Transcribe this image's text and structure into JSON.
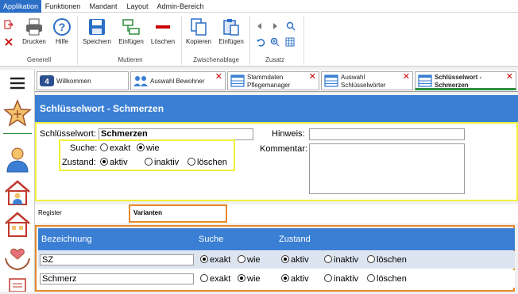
{
  "menubar": {
    "tabs": [
      {
        "label": "Applikation",
        "active": true
      },
      {
        "label": "Funktionen",
        "active": false
      },
      {
        "label": "Mandant",
        "active": false
      },
      {
        "label": "Layout",
        "active": false
      },
      {
        "label": "Admin-Bereich",
        "active": false
      }
    ]
  },
  "ribbon": {
    "print": "Drucken",
    "help": "Hilfe",
    "group_general": "Generell",
    "save": "Speichern",
    "insert": "Einfügen",
    "delete": "Löschen",
    "group_mutieren": "Mutieren",
    "copy": "Kopieren",
    "paste": "Einfügen",
    "group_clipboard": "Zwischenablage",
    "group_zusatz": "Zusatz"
  },
  "doctabs": [
    {
      "label": "Willkommen",
      "closable": false
    },
    {
      "label": "Auswahl Bewohner",
      "closable": true
    },
    {
      "label": "Stammdaten Pflegemanager",
      "closable": true
    },
    {
      "label": "Auswahl Schlüsselwörter",
      "closable": true
    },
    {
      "label": "Schlüsselwort - Schmerzen",
      "closable": true
    }
  ],
  "page": {
    "title": "Schlüsselwort - Schmerzen"
  },
  "form": {
    "keyword_label": "Schlüsselwort:",
    "keyword_value": "Schmerzen",
    "hint_label": "Hinweis:",
    "hint_value": "",
    "comment_label": "Kommentar:",
    "comment_value": "",
    "search_label": "Suche:",
    "search_options": [
      "exakt",
      "wie"
    ],
    "search_selected": "wie",
    "state_label": "Zustand:",
    "state_options": [
      "aktiv",
      "inaktiv",
      "löschen"
    ],
    "state_selected": "aktiv"
  },
  "subtabs": {
    "register": "Register",
    "variants": "Varianten"
  },
  "table": {
    "headers": [
      "Bezeichnung",
      "Suche",
      "Zustand"
    ],
    "rows": [
      {
        "name": "SZ",
        "search": "exakt",
        "state": "aktiv"
      },
      {
        "name": "Schmerz",
        "search": "wie",
        "state": "aktiv"
      }
    ],
    "search_options": [
      "exakt",
      "wie"
    ],
    "state_options": [
      "aktiv",
      "inaktiv",
      "löschen"
    ]
  },
  "colors": {
    "accent": "#3a7fd4",
    "highlight_yellow": "#f0f03c",
    "highlight_orange": "#e8892a"
  }
}
